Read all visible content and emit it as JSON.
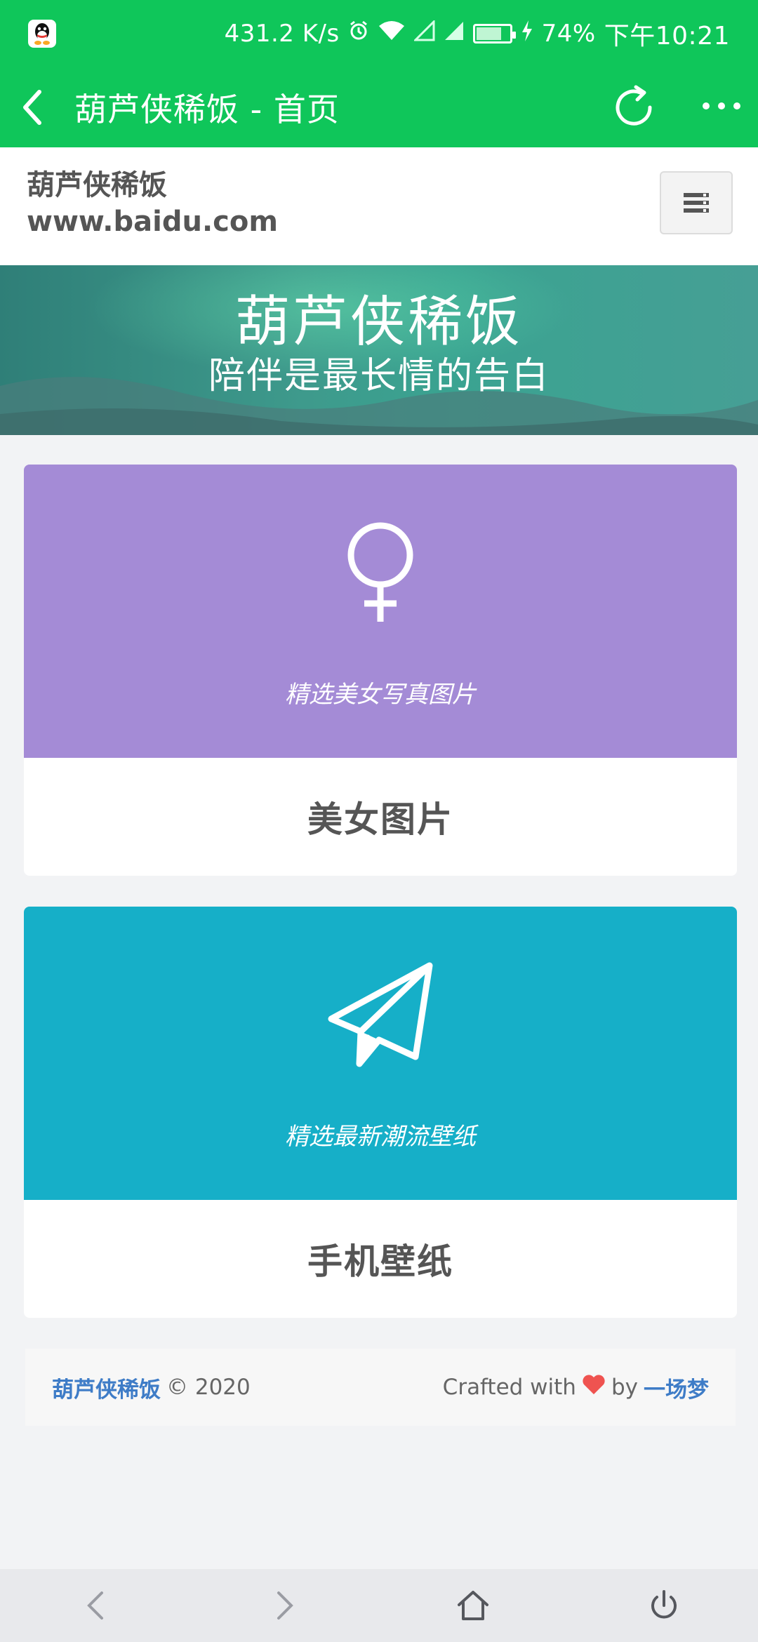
{
  "status_bar": {
    "network_speed": "431.2 K/s",
    "battery_percent": "74%",
    "time": "下午10:21",
    "icons": [
      "qq-icon",
      "alarm-icon",
      "wifi-icon",
      "signal-icon",
      "signal-icon",
      "battery-icon",
      "charging-icon"
    ]
  },
  "title_bar": {
    "title": "葫芦侠稀饭 - 首页",
    "icons": [
      "back-icon",
      "refresh-icon",
      "more-icon"
    ]
  },
  "site_header": {
    "name": "葫芦侠稀饭",
    "domain": "www.baidu.com",
    "menu_icon": "menu-icon"
  },
  "banner": {
    "title": "葫芦侠稀饭",
    "subtitle": "陪伴是最长情的告白"
  },
  "cards": [
    {
      "icon": "female-symbol-icon",
      "description": "精选美女写真图片",
      "label": "美女图片",
      "color": "#a48bd6"
    },
    {
      "icon": "paper-plane-icon",
      "description": "精选最新潮流壁纸",
      "label": "手机壁纸",
      "color": "#16afc8"
    }
  ],
  "footer": {
    "brand": "葫芦侠稀饭",
    "copyright": "© 2020",
    "crafted_with": "Crafted with",
    "by": "by",
    "author": "一场梦"
  },
  "nav_bar": {
    "icons": [
      "nav-back-icon",
      "nav-forward-icon",
      "home-icon",
      "power-icon"
    ]
  },
  "colors": {
    "accent": "#0fc65a",
    "link": "#3e7cc7",
    "heart": "#ef5350"
  }
}
